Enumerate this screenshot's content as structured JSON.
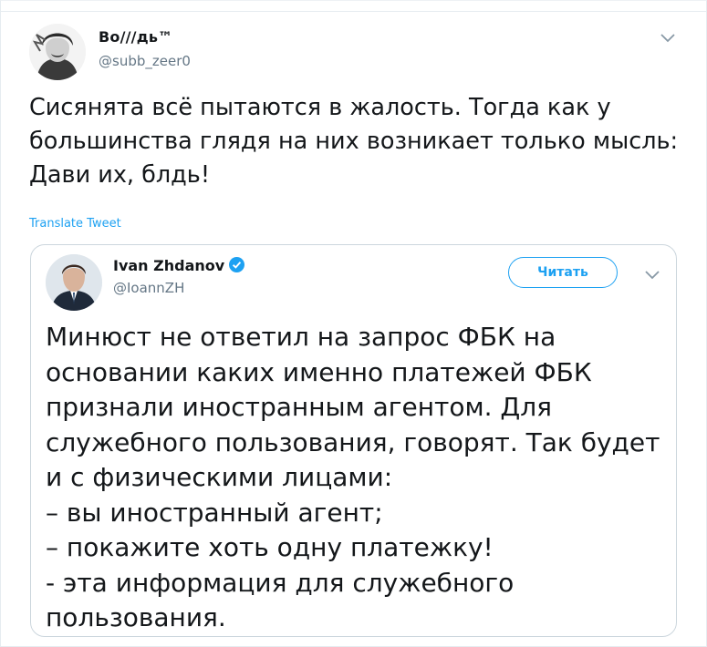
{
  "tweet": {
    "display_name": "Bo///дь™",
    "handle": "@subb_zeer0",
    "text": "Сисянята всё пытаются в жалость. Тогда как у большинства глядя на них возникает только мысль: Дави их, блдь!",
    "translate_label": "Translate Tweet",
    "avatar_icon": "portrait-avatar-icon",
    "menu_icon": "chevron-down-icon"
  },
  "quoted_tweet": {
    "display_name": "Ivan Zhdanov",
    "verified": true,
    "handle": "@IoannZH",
    "follow_label": "Читать",
    "menu_icon": "chevron-down-icon",
    "text": "Минюст не ответил на запрос ФБК на основании каких именно платежей ФБК признали иностранным агентом. Для служебного пользования, говорят. Так будет и с физическими лицами:\n– вы иностранный агент;\n– покажите хоть одну платежку!\n- эта информация для служебного пользования."
  },
  "colors": {
    "accent": "#1da1f2",
    "text": "#14171a",
    "muted": "#657786",
    "border": "#ccd6dd"
  }
}
